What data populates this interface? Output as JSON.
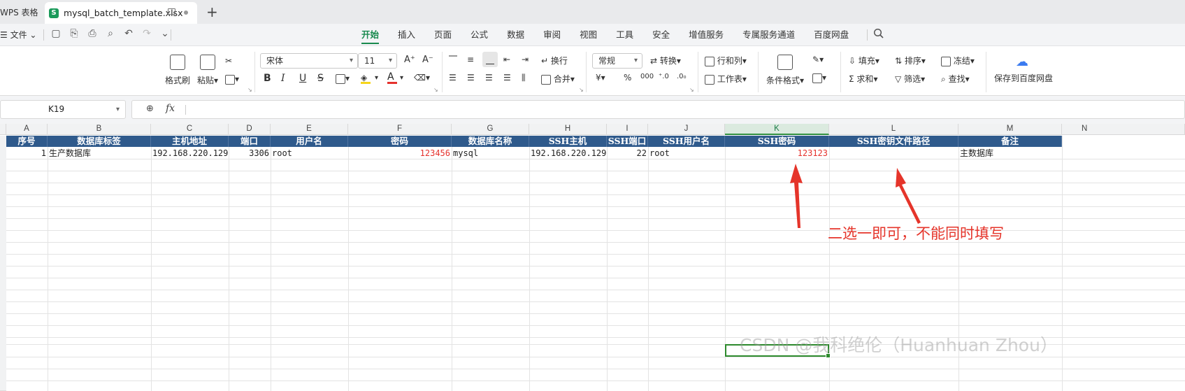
{
  "titlebar": {
    "app_tab": "WPS 表格",
    "file_tab": "mysql_batch_template.xlsx",
    "new_tab_label": "+"
  },
  "menu": {
    "file_label": "文件",
    "tabs": [
      "开始",
      "插入",
      "页面",
      "公式",
      "数据",
      "审阅",
      "视图",
      "工具",
      "安全",
      "增值服务",
      "专属服务通道",
      "百度网盘"
    ],
    "active_tab": "开始"
  },
  "ribbon": {
    "format_painter": "格式刷",
    "paste": "粘贴",
    "font_name": "宋体",
    "font_size": "11",
    "bold": "B",
    "italic": "I",
    "underline": "U",
    "strikethrough": "S",
    "wrap": "换行",
    "merge": "合并",
    "number_format": "常规",
    "convert": "转换",
    "rows_cols": "行和列",
    "worksheet": "工作表",
    "cond_format": "条件格式",
    "fill": "填充",
    "sort": "排序",
    "freeze": "冻结",
    "sum": "求和",
    "filter": "筛选",
    "find": "查找",
    "save_baidu": "保存到百度网盘",
    "currency": "¥",
    "percent": "%",
    "thousands": "000"
  },
  "formula_bar": {
    "name_box": "K19",
    "fx": "fx",
    "content": ""
  },
  "sheet": {
    "columns": [
      "A",
      "B",
      "C",
      "D",
      "E",
      "F",
      "G",
      "H",
      "I",
      "J",
      "K",
      "L",
      "M",
      "N"
    ],
    "selected_column": "K",
    "header_row": [
      "序号",
      "数据库标签",
      "主机地址",
      "端口",
      "用户名",
      "密码",
      "数据库名称",
      "SSH主机",
      "SSH端口",
      "SSH用户名",
      "SSH密码",
      "SSH密钥文件路径",
      "备注"
    ],
    "data_row": [
      "1",
      "生产数据库",
      "192.168.220.129",
      "3306",
      "root",
      "123456",
      "mysql",
      "192.168.220.129",
      "22",
      "root",
      "123123",
      "",
      "主数据库"
    ],
    "highlight_color": "#e5322d",
    "header_bg": "#2f5a8c"
  },
  "annotation": {
    "text": "二选一即可，不能同时填写",
    "color": "#e5342a"
  },
  "watermark": "CSDN @我科绝伦（Huanhuan Zhou）"
}
